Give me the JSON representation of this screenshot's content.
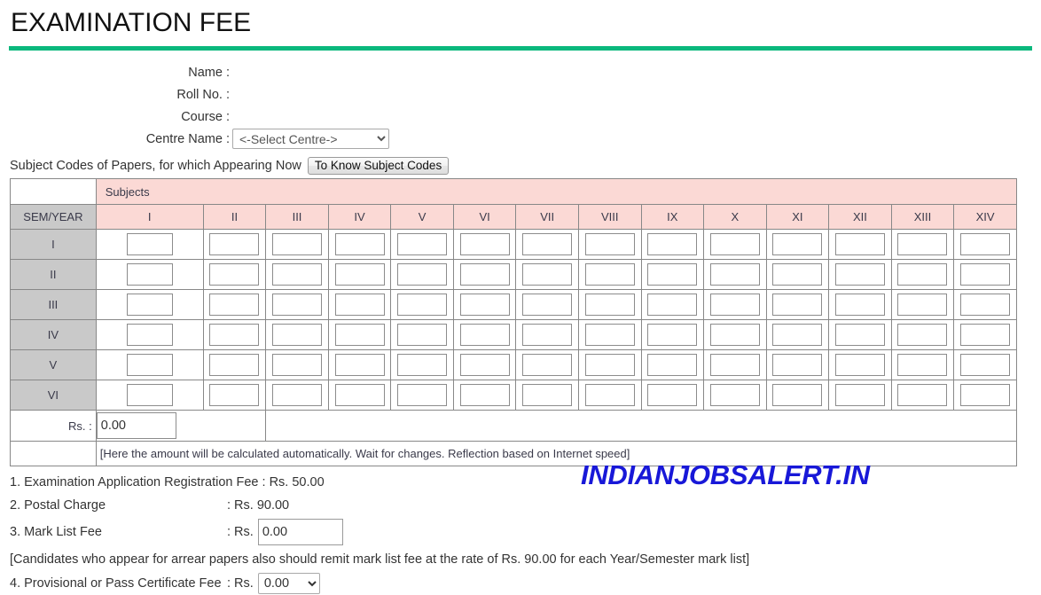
{
  "header": {
    "title": "EXAMINATION FEE",
    "rule_color": "#0bb87d"
  },
  "candidate": {
    "name_label": "Name :",
    "name_value": "",
    "roll_label": "Roll No. :",
    "roll_value": "",
    "course_label": "Course :",
    "course_value": "",
    "centre_label": "Centre Name :",
    "centre_selected": "<-Select Centre->",
    "centre_options": [
      "<-Select Centre->"
    ]
  },
  "subject_codes": {
    "instruction": "Subject Codes of Papers, for which Appearing Now",
    "button_label": "To Know Subject Codes"
  },
  "grid": {
    "subjects_header": "Subjects",
    "sem_header": "SEM/YEAR",
    "columns": [
      "I",
      "II",
      "III",
      "IV",
      "V",
      "VI",
      "VII",
      "VIII",
      "IX",
      "X",
      "XI",
      "XII",
      "XIII",
      "XIV"
    ],
    "rows": [
      "I",
      "II",
      "III",
      "IV",
      "V",
      "VI"
    ],
    "cell_value": "",
    "total_label": "Rs. :",
    "total_value": "0.00",
    "note": "[Here the amount will be calculated automatically. Wait for changes. Reflection based on Internet speed]"
  },
  "fees": {
    "item1_name": "1. Examination Application Registration Fee : Rs. 50.00",
    "item2_name": "2. Postal Charge",
    "item2_value": ": Rs. 90.00",
    "item3_name": "3. Mark List Fee",
    "item3_colon": ": Rs.",
    "item3_value": "0.00",
    "arrear_note": "[Candidates who appear for arrear papers also should remit mark list fee at the rate of Rs. 90.00 for each Year/Semester mark list]",
    "item4_name": "4. Provisional or Pass Certificate Fee",
    "item4_colon": ": Rs.",
    "item4_selected": "0.00",
    "item4_options": [
      "0.00"
    ]
  },
  "watermark": {
    "text": "INDIANJOBSALERT.IN",
    "color": "#1818d8"
  },
  "colors": {
    "subjects_bg": "#fbd9d5",
    "sem_bg": "#c9c9c9",
    "accent_green": "#0bb87d"
  }
}
